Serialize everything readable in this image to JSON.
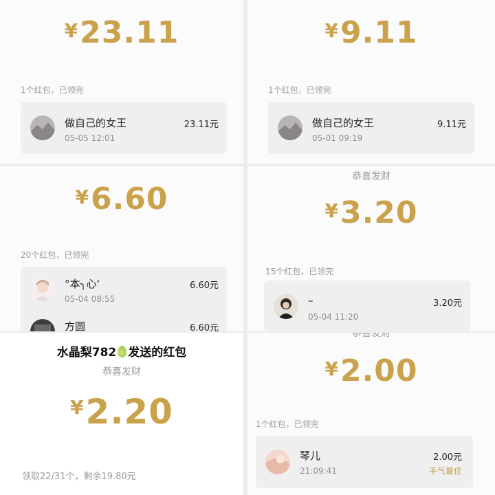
{
  "p1": {
    "currency": "¥",
    "amount": "23.11",
    "info": "1个红包，已领完",
    "record": {
      "name": "做自己的女王",
      "time": "05-05 12:01",
      "amount": "23.11元"
    }
  },
  "p2": {
    "currency": "¥",
    "amount": "9.11",
    "info": "1个红包，已领完",
    "record": {
      "name": "做自己的女王",
      "time": "05-01 09:19",
      "amount": "9.11元"
    }
  },
  "p3": {
    "currency": "¥",
    "amount": "6.60",
    "info": "20个红包，已领完",
    "records": [
      {
        "name": "°本╮心‘",
        "time": "05-04 08:55",
        "amount": "6.60元"
      },
      {
        "name": "方圆",
        "amount": "6.60元"
      }
    ]
  },
  "p4": {
    "subtitle": "恭喜发财",
    "currency": "¥",
    "amount": "3.20",
    "info": "15个红包，已领完",
    "record": {
      "name": "–",
      "time": "05-04 11:20",
      "amount": "3.20元"
    }
  },
  "p5": {
    "sender_pre": "水晶梨782",
    "sender_post": "发送的红包",
    "subtitle": "恭喜发财",
    "currency": "¥",
    "amount": "2.20",
    "info": "领取22/31个，剩余19.80元"
  },
  "p6": {
    "subtitle": "恭喜发财",
    "currency": "¥",
    "amount": "2.00",
    "info": "1个红包，已领完",
    "record": {
      "name": "琴儿",
      "time": "21:09:41",
      "amount": "2.00元",
      "badge": "手气最佳"
    }
  },
  "colors": {
    "gold": "#c9a24b",
    "card": "#efefef",
    "panel": "#fbfbfb"
  }
}
